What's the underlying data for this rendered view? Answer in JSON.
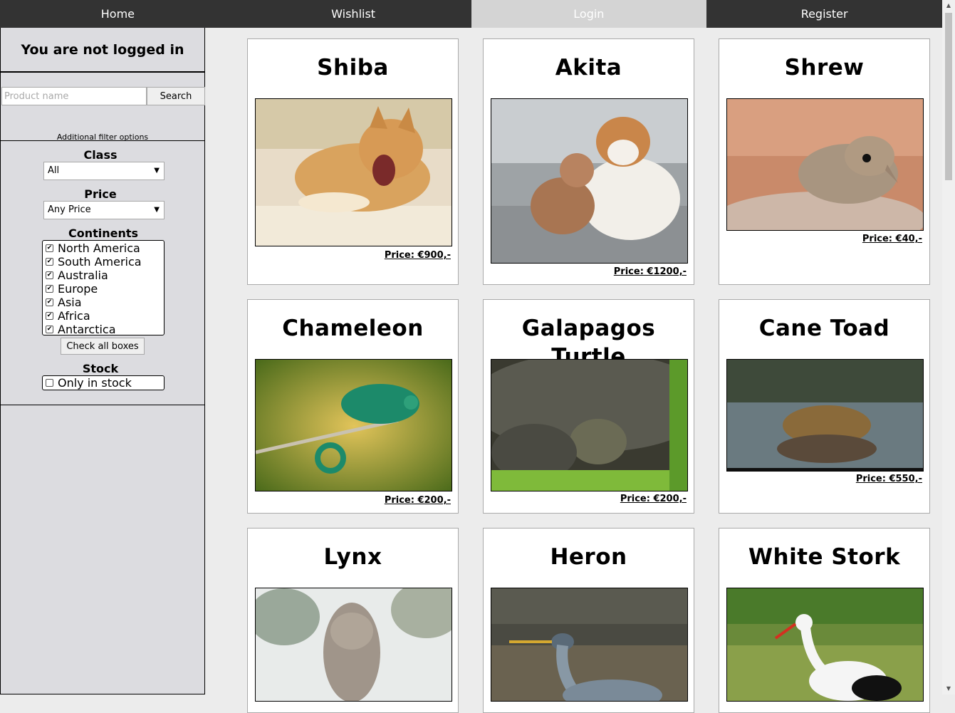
{
  "nav": {
    "items": [
      {
        "label": "Home"
      },
      {
        "label": "Wishlist"
      },
      {
        "label": "Login"
      },
      {
        "label": "Register"
      }
    ]
  },
  "sidebar": {
    "login_status": "You are not logged in",
    "search_placeholder": "Product name",
    "search_button": "Search",
    "additional_filter": "Additional filter options",
    "class_label": "Class",
    "class_value": "All",
    "price_label": "Price",
    "price_value": "Any Price",
    "continents_label": "Continents",
    "continents": [
      {
        "label": "North America",
        "checked": true
      },
      {
        "label": "South America",
        "checked": true
      },
      {
        "label": "Australia",
        "checked": true
      },
      {
        "label": "Europe",
        "checked": true
      },
      {
        "label": "Asia",
        "checked": true
      },
      {
        "label": "Africa",
        "checked": true
      },
      {
        "label": "Antarctica",
        "checked": true
      }
    ],
    "check_all_button": "Check all boxes",
    "stock_label": "Stock",
    "stock_option": "Only in stock"
  },
  "products": [
    {
      "name": "Shiba",
      "price": "Price: €900,-",
      "image": "shiba-dog-photo"
    },
    {
      "name": "Akita",
      "price": "Price: €1200,-",
      "image": "akita-dogs-photo"
    },
    {
      "name": "Shrew",
      "price": "Price: €40,-",
      "image": "shrew-photo"
    },
    {
      "name": "Chameleon",
      "price": "Price: €200,-",
      "image": "chameleon-photo"
    },
    {
      "name": "Galapagos Turtle",
      "price": "Price: €200,-",
      "image": "turtle-photo"
    },
    {
      "name": "Cane Toad",
      "price": "Price: €550,-",
      "image": "toad-photo"
    },
    {
      "name": "Lynx",
      "price": "",
      "image": "lynx-photo"
    },
    {
      "name": "Heron",
      "price": "",
      "image": "heron-photo"
    },
    {
      "name": "White Stork",
      "price": "",
      "image": "stork-photo"
    }
  ]
}
